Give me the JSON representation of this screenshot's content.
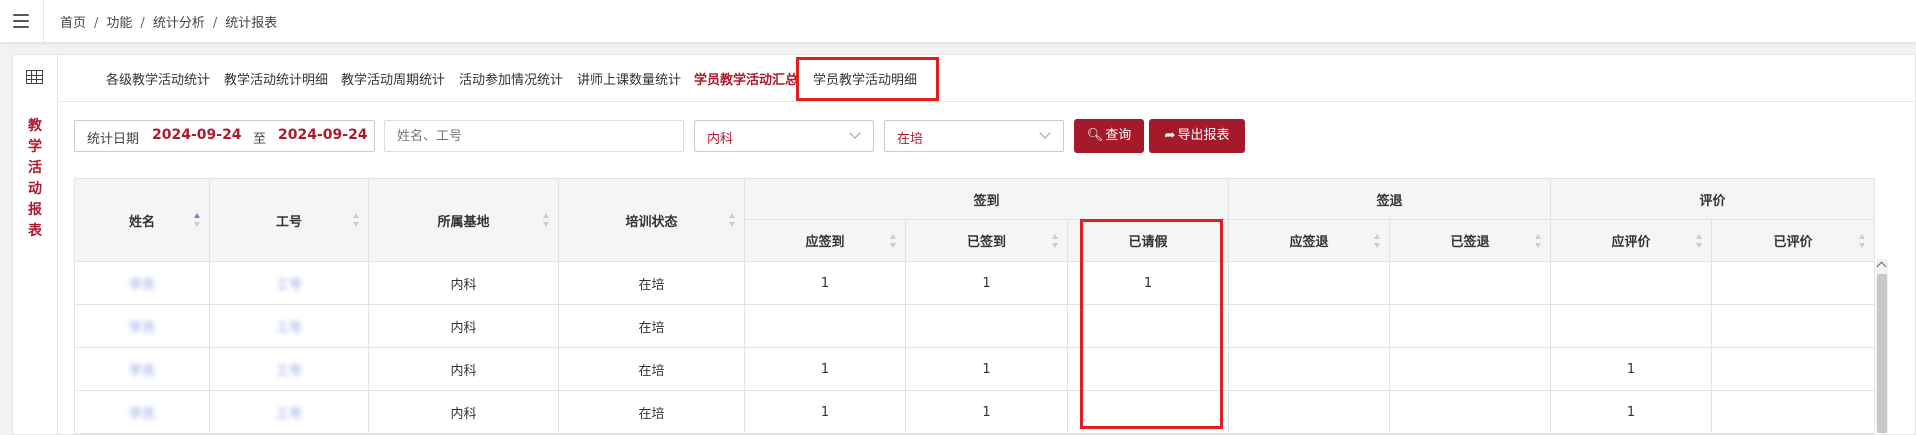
{
  "breadcrumb": [
    "首页",
    "功能",
    "统计分析",
    "统计报表"
  ],
  "sidebar": {
    "title_chars": [
      "教",
      "学",
      "活",
      "动",
      "报",
      "表"
    ]
  },
  "tabs": [
    {
      "label": "各级教学活动统计",
      "active": false
    },
    {
      "label": "教学活动统计明细",
      "active": false
    },
    {
      "label": "教学活动周期统计",
      "active": false
    },
    {
      "label": "活动参加情况统计",
      "active": false
    },
    {
      "label": "讲师上课数量统计",
      "active": false
    },
    {
      "label": "学员教学活动汇总",
      "active": true
    },
    {
      "label": "学员教学活动明细",
      "active": false
    }
  ],
  "filters": {
    "date_label": "统计日期",
    "date_from": "2024-09-24",
    "date_to_label": "至",
    "date_to": "2024-09-24",
    "search_placeholder": "姓名、工号",
    "base_select": "内科",
    "status_select": "在培",
    "query_label": "查询",
    "export_label": "导出报表"
  },
  "table": {
    "group_headers": {
      "signin": "签到",
      "signout": "签退",
      "evaluation": "评价"
    },
    "columns": {
      "name": "姓名",
      "id": "工号",
      "base": "所属基地",
      "status": "培训状态",
      "should_sign": "应签到",
      "signed": "已签到",
      "leave": "已请假",
      "should_signout": "应签退",
      "signed_out": "已签退",
      "should_eval": "应评价",
      "evaluated": "已评价"
    },
    "rows": [
      {
        "name": "学员",
        "id": "工号",
        "base": "内科",
        "status": "在培",
        "should_sign": "1",
        "signed": "1",
        "leave": "1",
        "should_signout": "",
        "signed_out": "",
        "should_eval": "",
        "evaluated": ""
      },
      {
        "name": "学员",
        "id": "工号",
        "base": "内科",
        "status": "在培",
        "should_sign": "",
        "signed": "",
        "leave": "",
        "should_signout": "",
        "signed_out": "",
        "should_eval": "",
        "evaluated": ""
      },
      {
        "name": "学员",
        "id": "工号",
        "base": "内科",
        "status": "在培",
        "should_sign": "1",
        "signed": "1",
        "leave": "",
        "should_signout": "",
        "signed_out": "",
        "should_eval": "1",
        "evaluated": ""
      },
      {
        "name": "学员",
        "id": "工号",
        "base": "内科",
        "status": "在培",
        "should_sign": "1",
        "signed": "1",
        "leave": "",
        "should_signout": "",
        "signed_out": "",
        "should_eval": "1",
        "evaluated": ""
      }
    ]
  },
  "colors": {
    "accent": "#b0182c",
    "button": "#a51a2b",
    "highlight_box": "#e02020"
  },
  "icons": {
    "menu": "hamburger-icon",
    "grid": "grid-icon",
    "search": "search-icon",
    "export": "share-icon"
  }
}
